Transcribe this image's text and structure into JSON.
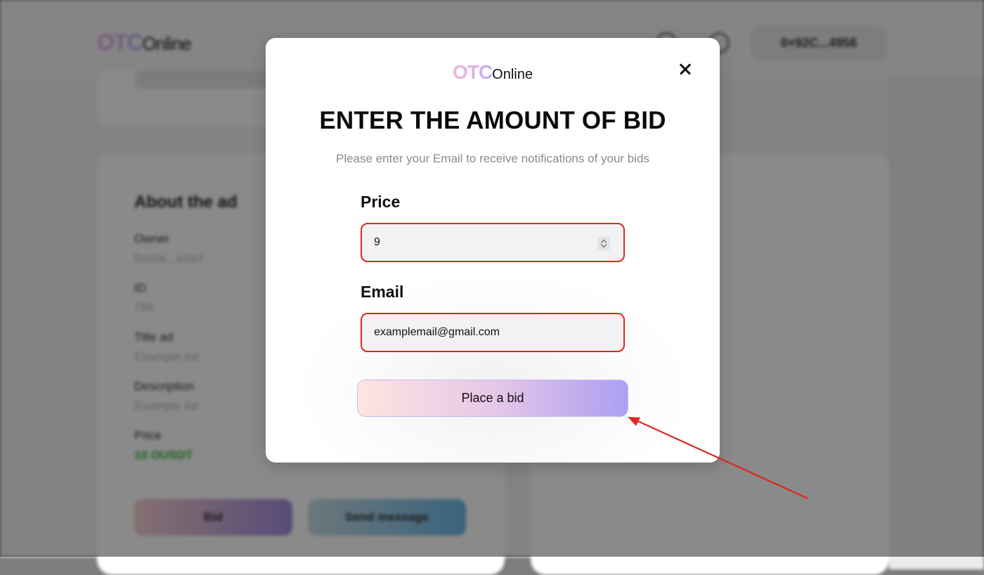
{
  "background": {
    "logo": {
      "otc": "OTC",
      "online": "Online"
    },
    "wallet": "0×92C...4956",
    "about": {
      "title": "About the ad",
      "fields": [
        {
          "label": "Owner",
          "value": "0xc0e...a3a3"
        },
        {
          "label": "ID",
          "value": "796"
        },
        {
          "label": "Title ad",
          "value": "Example Ad"
        },
        {
          "label": "Description",
          "value": "Example Ad"
        },
        {
          "label": "Price",
          "value": "10 OUSDT"
        }
      ],
      "buttons": {
        "bid": "Bid",
        "send_message": "Send message"
      }
    }
  },
  "modal": {
    "logo": {
      "otc": "OTC",
      "online": "Online"
    },
    "title": "ENTER THE AMOUNT OF BID",
    "subtitle": "Please enter your Email to receive notifications of your bids",
    "price": {
      "label": "Price",
      "value": "9"
    },
    "email": {
      "label": "Email",
      "value": "examplemail@gmail.com"
    },
    "submit_label": "Place a bid"
  },
  "annotation": {
    "arrow_color": "#e0271f",
    "highlight_color": "#e0271f"
  }
}
